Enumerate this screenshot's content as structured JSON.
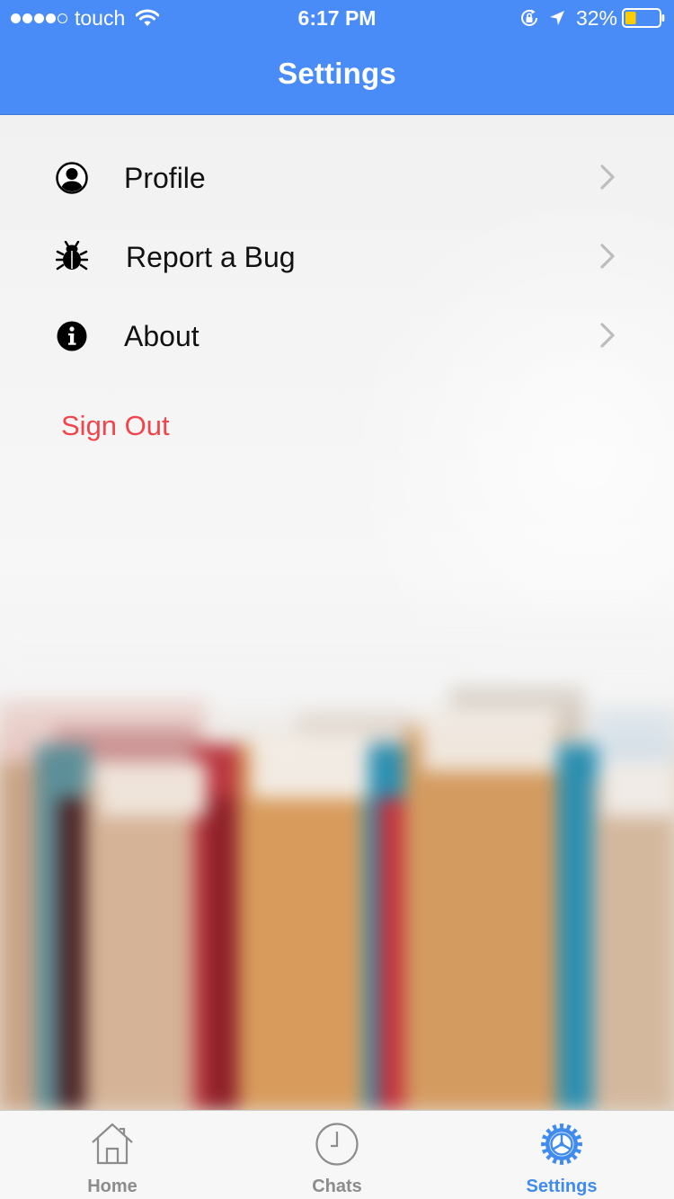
{
  "status_bar": {
    "carrier": "touch",
    "time": "6:17 PM",
    "battery_percent": "32%",
    "battery_level": 0.32,
    "signal_bars_filled": 4,
    "icons": [
      "wifi-icon",
      "orientation-lock-icon",
      "location-arrow-icon",
      "battery-icon"
    ]
  },
  "nav": {
    "title": "Settings"
  },
  "menu": {
    "items": [
      {
        "label": "Profile",
        "icon": "profile-icon"
      },
      {
        "label": "Report a Bug",
        "icon": "bug-icon"
      },
      {
        "label": "About",
        "icon": "info-icon"
      }
    ],
    "sign_out": "Sign Out"
  },
  "tabs": [
    {
      "label": "Home",
      "icon": "home-icon",
      "active": false
    },
    {
      "label": "Chats",
      "icon": "clock-icon",
      "active": false
    },
    {
      "label": "Settings",
      "icon": "gear-icon",
      "active": true
    }
  ],
  "colors": {
    "nav_blue": "#4a8cf7",
    "sign_out_red": "#f0464b",
    "active_tab_blue": "#3f8bf0",
    "inactive_tab_gray": "#8c8c8c",
    "battery_yellow": "#ffcc00"
  }
}
